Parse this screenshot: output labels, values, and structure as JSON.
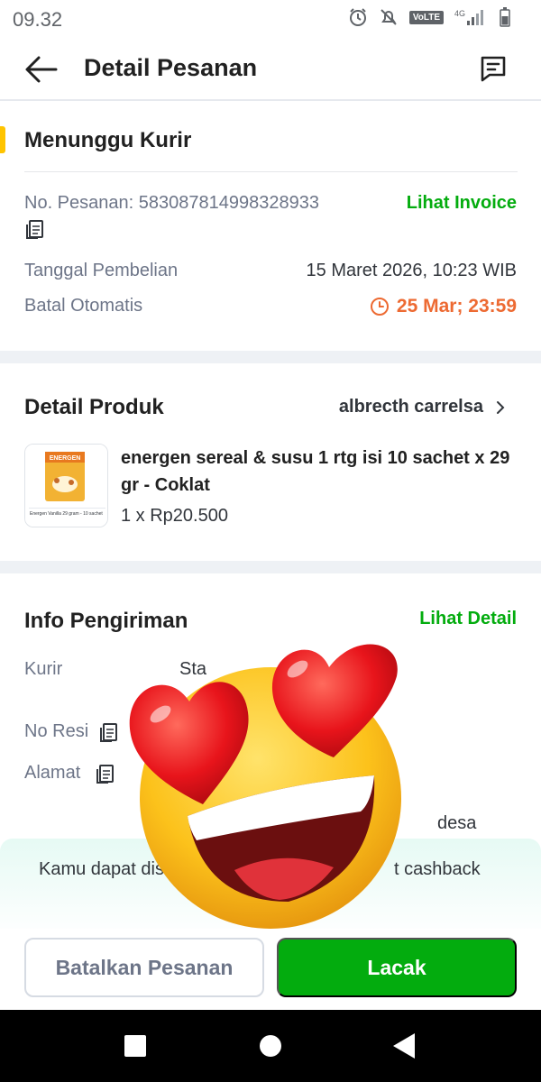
{
  "status_bar": {
    "time": "09.32",
    "network": "VoLTE",
    "signal_type": "4G"
  },
  "header": {
    "title": "Detail Pesanan"
  },
  "order_status": {
    "title": "Menunggu Kurir",
    "order_number_label": "No. Pesanan: 583087814998328933",
    "invoice_link": "Lihat Invoice",
    "purchase_date_label": "Tanggal Pembelian",
    "purchase_date_value": "15 Maret 2026, 10:23 WIB",
    "auto_cancel_label": "Batal Otomatis",
    "auto_cancel_value": "25 Mar; 23:59"
  },
  "product_detail": {
    "title": "Detail Produk",
    "seller": "albrecth carrelsa",
    "thumb_brand": "ENERGEN",
    "thumb_caption": "Energen Vanilla 29 gram - 10 sachet",
    "product_name": "energen sereal & susu 1 rtg isi 10 sachet x 29 gr - Coklat",
    "quantity_price": "1 x Rp20.500"
  },
  "shipping": {
    "title": "Info Pengiriman",
    "detail_link": "Lihat Detail",
    "courier_label": "Kurir",
    "courier_value_partial": "Sta",
    "tracking_label": "No Resi",
    "address_label": "Alamat",
    "address_partial": "desa"
  },
  "cashback": {
    "text_left": "Kamu dapat dis",
    "text_right": "t cashback"
  },
  "actions": {
    "cancel": "Batalkan Pesanan",
    "track": "Lacak"
  },
  "colors": {
    "green": "#03ac0e",
    "orange": "#ed6a32",
    "yellow": "#ffc400"
  }
}
